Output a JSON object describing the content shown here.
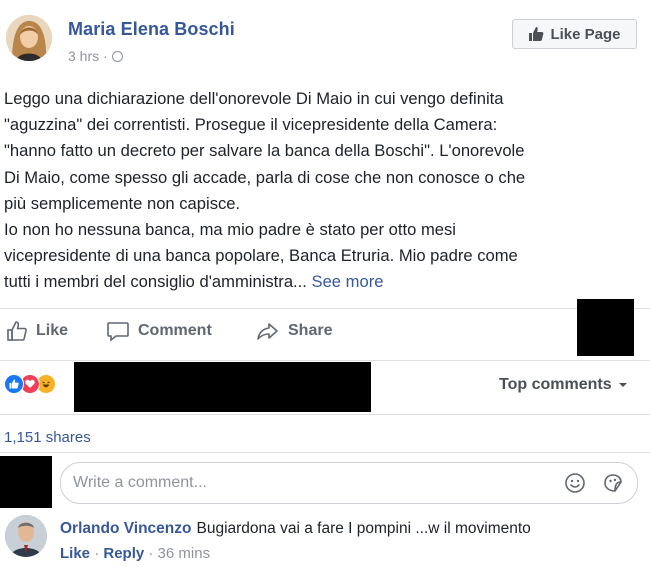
{
  "post": {
    "author": "Maria Elena Boschi",
    "time": "3 hrs ·",
    "like_page_label": "Like Page",
    "body_lines": [
      "Leggo una dichiarazione dell'onorevole Di Maio in cui vengo definita",
      "\"aguzzina\" dei correntisti. Prosegue il vicepresidente della Camera:",
      "\"hanno fatto un decreto per salvare la banca della Boschi\". L'onorevole",
      "Di Maio, come spesso gli accade, parla di cose che non conosce o che",
      "più semplicemente non capisce.",
      "Io non ho nessuna banca, ma mio padre è stato per otto mesi",
      "vicepresidente di una banca popolare, Banca Etruria. Mio padre come",
      "tutti i membri del consiglio d'amministra..."
    ],
    "see_more": "See more"
  },
  "actions": {
    "like": "Like",
    "comment": "Comment",
    "share": "Share"
  },
  "engagement": {
    "top_comments": "Top comments",
    "shares": "1,151 shares"
  },
  "comment_box": {
    "placeholder": "Write a comment..."
  },
  "comment": {
    "author": "Orlando Vincenzo",
    "text": "Bugiardona vai a fare I pompini ...w il movimento",
    "like": "Like",
    "separator": "·",
    "reply": "Reply",
    "time": "· 36 mins"
  },
  "colors": {
    "link_blue": "#365899",
    "gray_text": "#90949c",
    "like_blue": "#1877f2",
    "love_red": "#f33e58",
    "haha_yellow": "#f7b125"
  }
}
